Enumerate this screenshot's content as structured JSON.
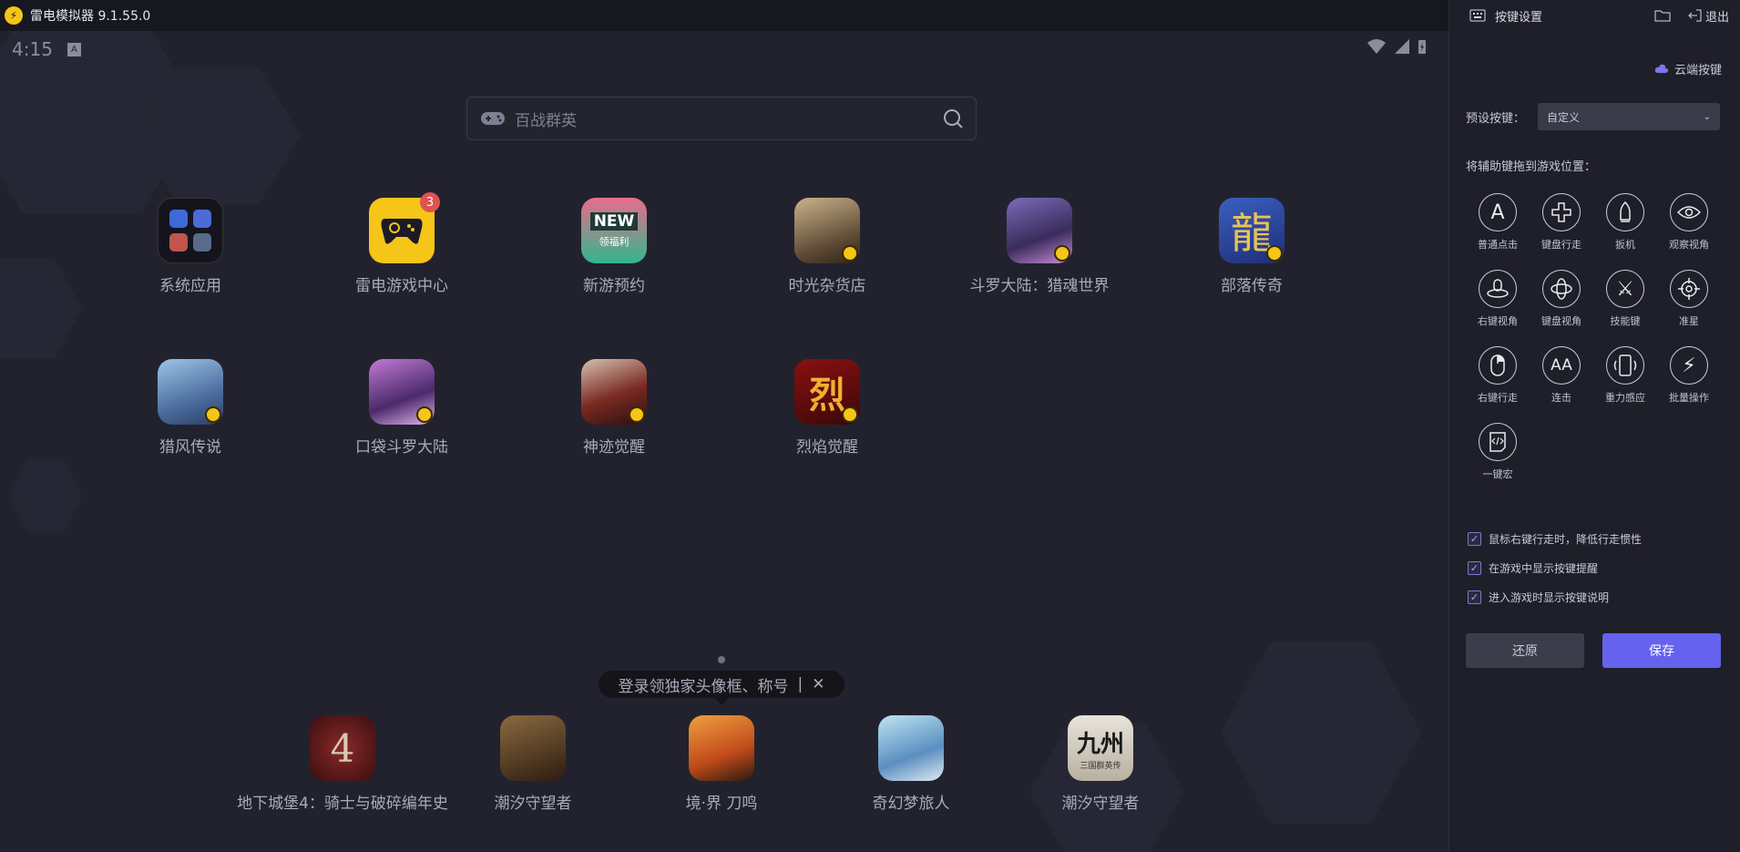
{
  "window": {
    "title": "雷电模拟器 9.1.55.0"
  },
  "status": {
    "time": "4:15",
    "badge": "A"
  },
  "search": {
    "placeholder": "百战群英"
  },
  "apps": [
    {
      "label": "系统应用"
    },
    {
      "label": "雷电游戏中心",
      "badge": "3"
    },
    {
      "label": "新游预约",
      "icon_text": "NEW",
      "icon_subtext": "领福利"
    },
    {
      "label": "时光杂货店"
    },
    {
      "label": "斗罗大陆：猎魂世界"
    },
    {
      "label": "部落传奇",
      "icon_text": "龍"
    },
    {
      "label": "猎风传说"
    },
    {
      "label": "口袋斗罗大陆"
    },
    {
      "label": "神迹觉醒"
    },
    {
      "label": "烈焰觉醒",
      "icon_text": "烈"
    }
  ],
  "tooltip": {
    "text": "登录领独家头像框、称号",
    "separator": "|",
    "close": "✕"
  },
  "dock": [
    {
      "label": "地下城堡4：骑士与破碎编年史"
    },
    {
      "label": "潮汐守望者"
    },
    {
      "label": "境·界 刀鸣"
    },
    {
      "label": "奇幻梦旅人"
    },
    {
      "label": "潮汐守望者",
      "icon_text": "九州",
      "icon_subtext": "三国群英传"
    }
  ],
  "panel": {
    "title": "按键设置",
    "exit_label": "退出",
    "cloud_label": "云端按键",
    "preset_label": "预设按键：",
    "preset_value": "自定义",
    "drag_hint": "将辅助键拖到游戏位置：",
    "keys": [
      {
        "label": "普通点击",
        "icon": "letter-a-icon",
        "glyph": "A"
      },
      {
        "label": "键盘行走",
        "icon": "dpad-icon",
        "glyph": "✚"
      },
      {
        "label": "扳机",
        "icon": "bullet-icon",
        "glyph": ""
      },
      {
        "label": "观察视角",
        "icon": "eye-icon",
        "glyph": ""
      },
      {
        "label": "右键视角",
        "icon": "mouse-view-icon",
        "glyph": ""
      },
      {
        "label": "键盘视角",
        "icon": "rotate-view-icon",
        "glyph": ""
      },
      {
        "label": "技能键",
        "icon": "swords-icon",
        "glyph": "⚔"
      },
      {
        "label": "准星",
        "icon": "crosshair-icon",
        "glyph": ""
      },
      {
        "label": "右键行走",
        "icon": "mouse-icon",
        "glyph": ""
      },
      {
        "label": "连击",
        "icon": "combo-icon",
        "glyph": "AA"
      },
      {
        "label": "重力感应",
        "icon": "phone-tilt-icon",
        "glyph": ""
      },
      {
        "label": "批量操作",
        "icon": "lightning-icon",
        "glyph": "⚡"
      },
      {
        "label": "一键宏",
        "icon": "macro-icon",
        "glyph": ""
      }
    ],
    "options": [
      {
        "label": "鼠标右键行走时，降低行走惯性",
        "checked": true
      },
      {
        "label": "在游戏中显示按键提醒",
        "checked": true
      },
      {
        "label": "进入游戏时显示按键说明",
        "checked": true
      }
    ],
    "reset_label": "还原",
    "save_label": "保存"
  },
  "colors": {
    "accent": "#6563ee",
    "background": "#22222f",
    "panel": "#1f1f29"
  }
}
